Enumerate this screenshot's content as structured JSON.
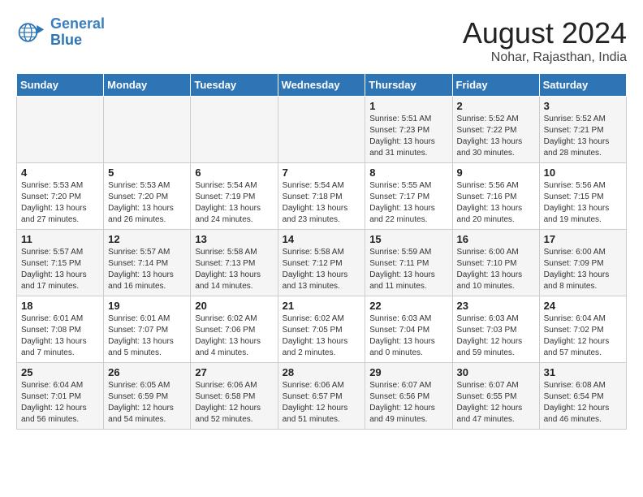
{
  "logo": {
    "text_general": "General",
    "text_blue": "Blue"
  },
  "title": "August 2024",
  "subtitle": "Nohar, Rajasthan, India",
  "days_of_week": [
    "Sunday",
    "Monday",
    "Tuesday",
    "Wednesday",
    "Thursday",
    "Friday",
    "Saturday"
  ],
  "weeks": [
    [
      {
        "day": "",
        "info": ""
      },
      {
        "day": "",
        "info": ""
      },
      {
        "day": "",
        "info": ""
      },
      {
        "day": "",
        "info": ""
      },
      {
        "day": "1",
        "info": "Sunrise: 5:51 AM\nSunset: 7:23 PM\nDaylight: 13 hours\nand 31 minutes."
      },
      {
        "day": "2",
        "info": "Sunrise: 5:52 AM\nSunset: 7:22 PM\nDaylight: 13 hours\nand 30 minutes."
      },
      {
        "day": "3",
        "info": "Sunrise: 5:52 AM\nSunset: 7:21 PM\nDaylight: 13 hours\nand 28 minutes."
      }
    ],
    [
      {
        "day": "4",
        "info": "Sunrise: 5:53 AM\nSunset: 7:20 PM\nDaylight: 13 hours\nand 27 minutes."
      },
      {
        "day": "5",
        "info": "Sunrise: 5:53 AM\nSunset: 7:20 PM\nDaylight: 13 hours\nand 26 minutes."
      },
      {
        "day": "6",
        "info": "Sunrise: 5:54 AM\nSunset: 7:19 PM\nDaylight: 13 hours\nand 24 minutes."
      },
      {
        "day": "7",
        "info": "Sunrise: 5:54 AM\nSunset: 7:18 PM\nDaylight: 13 hours\nand 23 minutes."
      },
      {
        "day": "8",
        "info": "Sunrise: 5:55 AM\nSunset: 7:17 PM\nDaylight: 13 hours\nand 22 minutes."
      },
      {
        "day": "9",
        "info": "Sunrise: 5:56 AM\nSunset: 7:16 PM\nDaylight: 13 hours\nand 20 minutes."
      },
      {
        "day": "10",
        "info": "Sunrise: 5:56 AM\nSunset: 7:15 PM\nDaylight: 13 hours\nand 19 minutes."
      }
    ],
    [
      {
        "day": "11",
        "info": "Sunrise: 5:57 AM\nSunset: 7:15 PM\nDaylight: 13 hours\nand 17 minutes."
      },
      {
        "day": "12",
        "info": "Sunrise: 5:57 AM\nSunset: 7:14 PM\nDaylight: 13 hours\nand 16 minutes."
      },
      {
        "day": "13",
        "info": "Sunrise: 5:58 AM\nSunset: 7:13 PM\nDaylight: 13 hours\nand 14 minutes."
      },
      {
        "day": "14",
        "info": "Sunrise: 5:58 AM\nSunset: 7:12 PM\nDaylight: 13 hours\nand 13 minutes."
      },
      {
        "day": "15",
        "info": "Sunrise: 5:59 AM\nSunset: 7:11 PM\nDaylight: 13 hours\nand 11 minutes."
      },
      {
        "day": "16",
        "info": "Sunrise: 6:00 AM\nSunset: 7:10 PM\nDaylight: 13 hours\nand 10 minutes."
      },
      {
        "day": "17",
        "info": "Sunrise: 6:00 AM\nSunset: 7:09 PM\nDaylight: 13 hours\nand 8 minutes."
      }
    ],
    [
      {
        "day": "18",
        "info": "Sunrise: 6:01 AM\nSunset: 7:08 PM\nDaylight: 13 hours\nand 7 minutes."
      },
      {
        "day": "19",
        "info": "Sunrise: 6:01 AM\nSunset: 7:07 PM\nDaylight: 13 hours\nand 5 minutes."
      },
      {
        "day": "20",
        "info": "Sunrise: 6:02 AM\nSunset: 7:06 PM\nDaylight: 13 hours\nand 4 minutes."
      },
      {
        "day": "21",
        "info": "Sunrise: 6:02 AM\nSunset: 7:05 PM\nDaylight: 13 hours\nand 2 minutes."
      },
      {
        "day": "22",
        "info": "Sunrise: 6:03 AM\nSunset: 7:04 PM\nDaylight: 13 hours\nand 0 minutes."
      },
      {
        "day": "23",
        "info": "Sunrise: 6:03 AM\nSunset: 7:03 PM\nDaylight: 12 hours\nand 59 minutes."
      },
      {
        "day": "24",
        "info": "Sunrise: 6:04 AM\nSunset: 7:02 PM\nDaylight: 12 hours\nand 57 minutes."
      }
    ],
    [
      {
        "day": "25",
        "info": "Sunrise: 6:04 AM\nSunset: 7:01 PM\nDaylight: 12 hours\nand 56 minutes."
      },
      {
        "day": "26",
        "info": "Sunrise: 6:05 AM\nSunset: 6:59 PM\nDaylight: 12 hours\nand 54 minutes."
      },
      {
        "day": "27",
        "info": "Sunrise: 6:06 AM\nSunset: 6:58 PM\nDaylight: 12 hours\nand 52 minutes."
      },
      {
        "day": "28",
        "info": "Sunrise: 6:06 AM\nSunset: 6:57 PM\nDaylight: 12 hours\nand 51 minutes."
      },
      {
        "day": "29",
        "info": "Sunrise: 6:07 AM\nSunset: 6:56 PM\nDaylight: 12 hours\nand 49 minutes."
      },
      {
        "day": "30",
        "info": "Sunrise: 6:07 AM\nSunset: 6:55 PM\nDaylight: 12 hours\nand 47 minutes."
      },
      {
        "day": "31",
        "info": "Sunrise: 6:08 AM\nSunset: 6:54 PM\nDaylight: 12 hours\nand 46 minutes."
      }
    ]
  ]
}
